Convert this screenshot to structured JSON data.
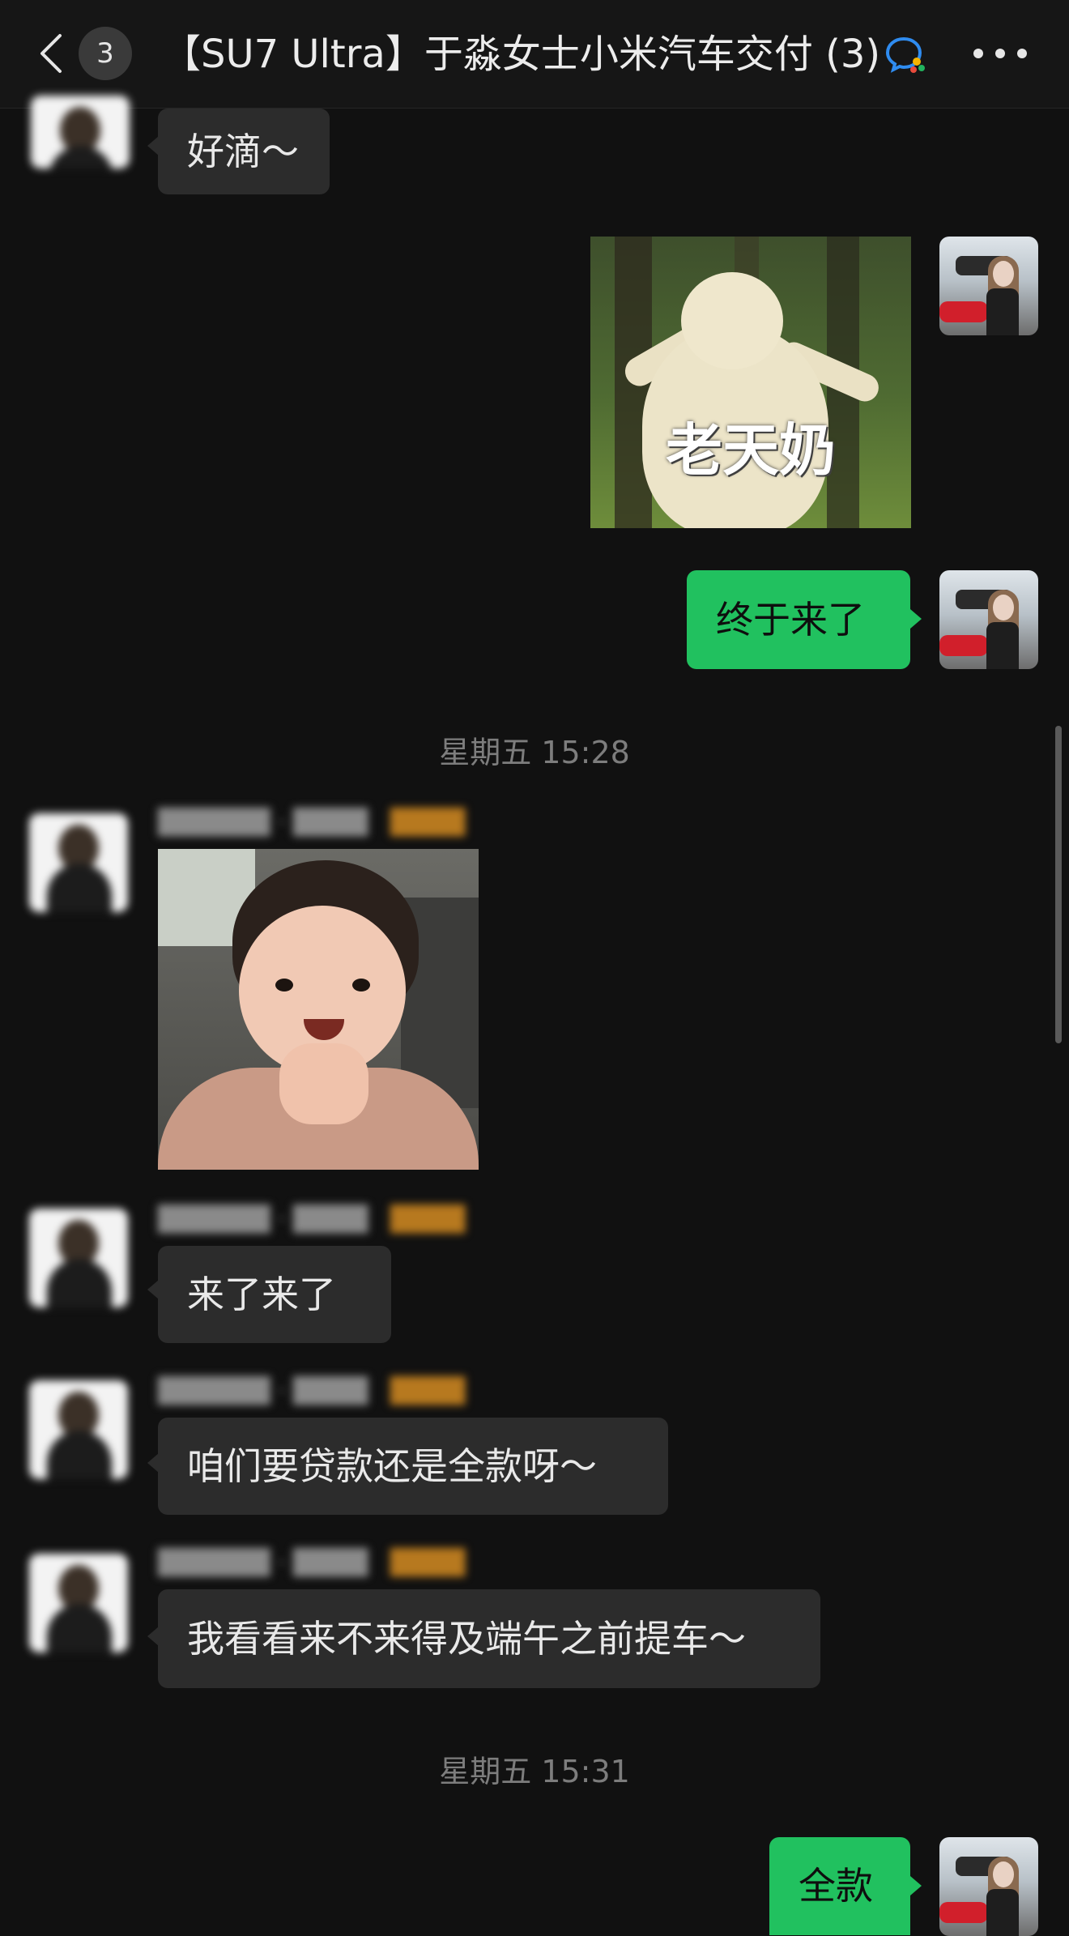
{
  "header": {
    "back_icon": "chevron-left-icon",
    "unread_count": "3",
    "title": "【SU7 Ultra】于淼女士小米汽车交付 (3)",
    "work_icon": "wecom-chat-icon",
    "more_icon": "more-dots-icon"
  },
  "messages": [
    {
      "id": "m1",
      "side": "in",
      "type": "text",
      "text": "好滴～"
    },
    {
      "id": "m2",
      "side": "out",
      "type": "sticker",
      "caption": "老天奶"
    },
    {
      "id": "m3",
      "side": "out",
      "type": "text",
      "text": "终于来了"
    },
    {
      "id": "t1",
      "type": "timestamp",
      "text": "星期五 15:28"
    },
    {
      "id": "m4",
      "side": "in",
      "type": "sticker"
    },
    {
      "id": "m5",
      "side": "in",
      "type": "text",
      "text": "来了来了"
    },
    {
      "id": "m6",
      "side": "in",
      "type": "text",
      "text": "咱们要贷款还是全款呀～"
    },
    {
      "id": "m7",
      "side": "in",
      "type": "text",
      "text": "我看看来不来得及端午之前提车～"
    },
    {
      "id": "t2",
      "type": "timestamp",
      "text": "星期五 15:31"
    },
    {
      "id": "m8",
      "side": "out",
      "type": "text",
      "text": "全款"
    }
  ],
  "colors": {
    "background": "#111111",
    "incoming_bubble": "#2c2c2c",
    "outgoing_bubble": "#21c15f",
    "timestamp_text": "#7d7d7d"
  }
}
